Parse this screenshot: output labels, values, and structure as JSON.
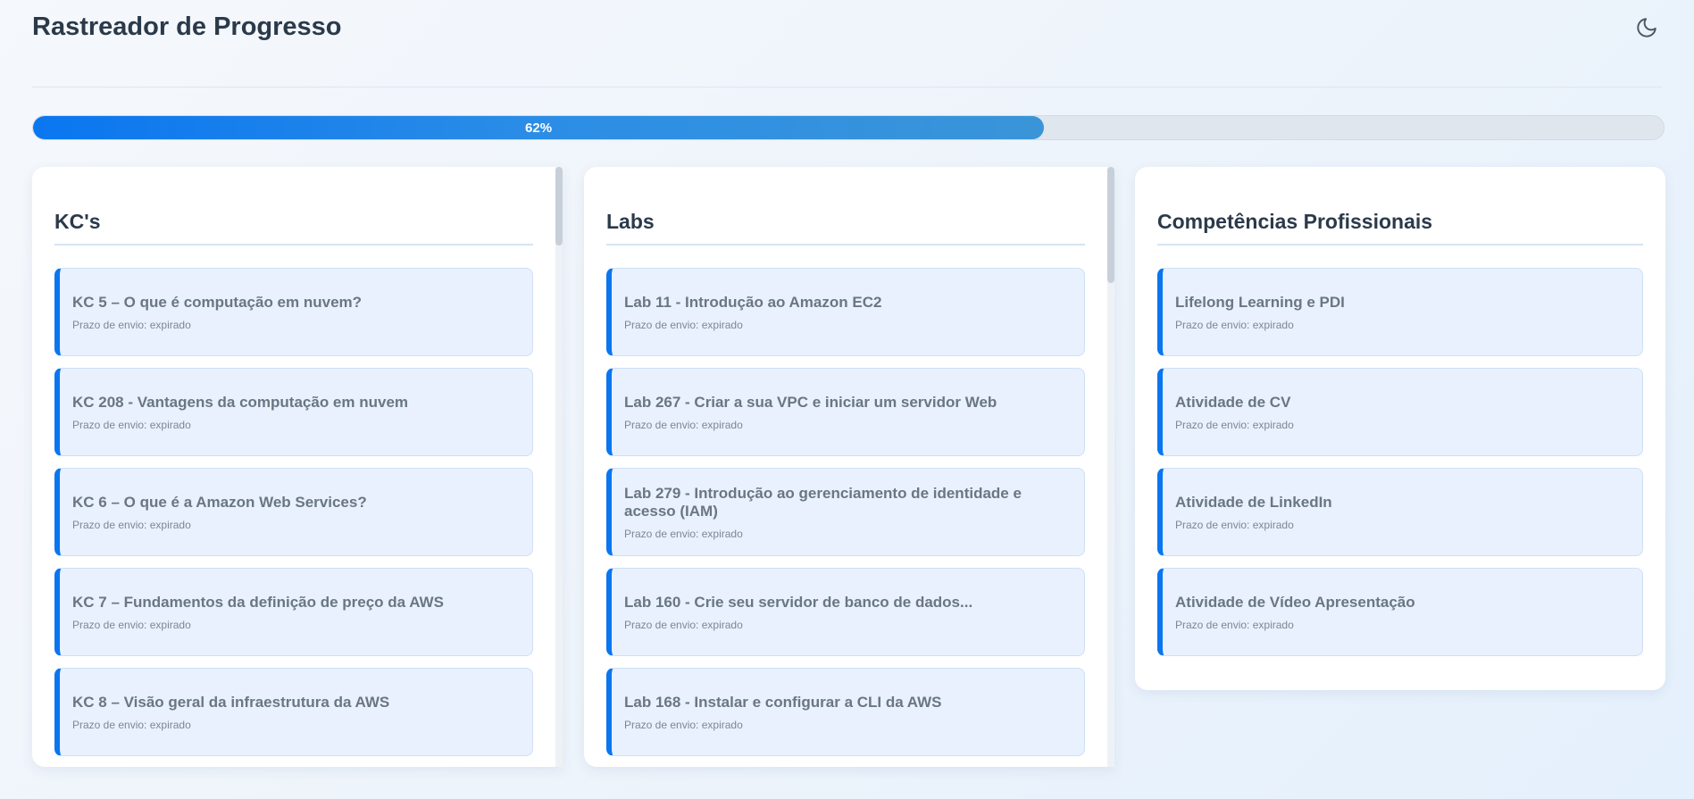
{
  "app": {
    "title": "Rastreador de Progresso",
    "theme_icon": "moon-icon"
  },
  "progress": {
    "percent": 62,
    "label": "62%",
    "fill_color": "#0a76f0"
  },
  "columns": [
    {
      "title": "KC's",
      "items": [
        {
          "title": "KC 5 – O que é computação em nuvem?",
          "deadline": "Prazo de envio: expirado"
        },
        {
          "title": "KC 208 - Vantagens da computação em nuvem",
          "deadline": "Prazo de envio: expirado"
        },
        {
          "title": "KC 6 – O que é a Amazon Web Services?",
          "deadline": "Prazo de envio: expirado"
        },
        {
          "title": "KC 7 – Fundamentos da definição de preço da AWS",
          "deadline": "Prazo de envio: expirado"
        },
        {
          "title": "KC 8 – Visão geral da infraestrutura da AWS",
          "deadline": "Prazo de envio: expirado"
        }
      ]
    },
    {
      "title": "Labs",
      "items": [
        {
          "title": "Lab 11 - Introdução ao Amazon EC2",
          "deadline": "Prazo de envio: expirado"
        },
        {
          "title": "Lab 267 - Criar a sua VPC e iniciar um servidor Web",
          "deadline": "Prazo de envio: expirado"
        },
        {
          "title": "Lab 279 - Introdução ao gerenciamento de identidade e acesso (IAM)",
          "deadline": "Prazo de envio: expirado"
        },
        {
          "title": "Lab 160 - Crie seu servidor de banco de dados...",
          "deadline": "Prazo de envio: expirado"
        },
        {
          "title": "Lab 168 - Instalar e configurar a CLI da AWS",
          "deadline": "Prazo de envio: expirado"
        }
      ]
    },
    {
      "title": "Competências Profissionais",
      "items": [
        {
          "title": "Lifelong Learning e PDI",
          "deadline": "Prazo de envio: expirado"
        },
        {
          "title": "Atividade de CV",
          "deadline": "Prazo de envio: expirado"
        },
        {
          "title": "Atividade de LinkedIn",
          "deadline": "Prazo de envio: expirado"
        },
        {
          "title": "Atividade de Vídeo Apresentação",
          "deadline": "Prazo de envio: expirado"
        }
      ]
    }
  ],
  "colors": {
    "accent": "#0a76f0",
    "card_bg": "#e8f1fd",
    "title_text": "#2b3a4a"
  }
}
